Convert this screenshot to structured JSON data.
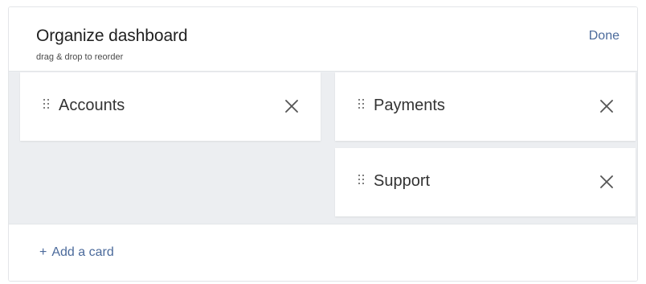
{
  "header": {
    "title": "Organize dashboard",
    "subtitle": "drag & drop to reorder",
    "done_label": "Done"
  },
  "cards": [
    {
      "label": "Accounts",
      "grip_icon": "drag-handle-icon",
      "close_icon": "close-icon"
    },
    {
      "label": "Payments",
      "grip_icon": "drag-handle-icon",
      "close_icon": "close-icon"
    },
    {
      "label": "Support",
      "grip_icon": "drag-handle-icon",
      "close_icon": "close-icon"
    }
  ],
  "footer": {
    "add_card_symbol": "+",
    "add_card_label": "Add a card"
  },
  "colors": {
    "accent": "#4b6a9b",
    "board_background": "#eceef1",
    "card_background": "#ffffff"
  }
}
